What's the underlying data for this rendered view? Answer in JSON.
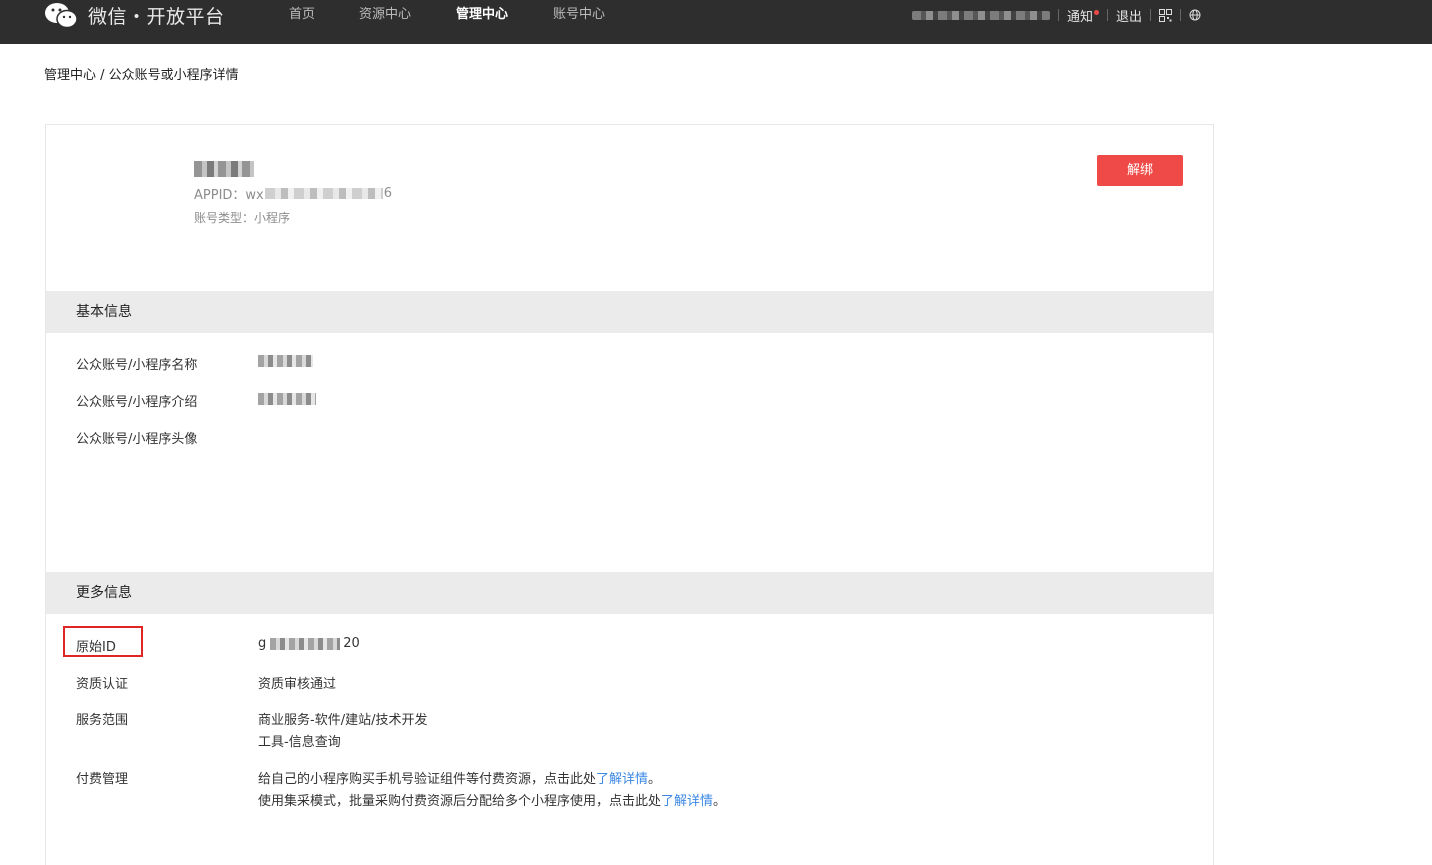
{
  "header": {
    "logo_text": "微信・开放平台",
    "nav": [
      "首页",
      "资源中心",
      "管理中心",
      "账号中心"
    ],
    "active_nav": "管理中心",
    "notice_label": "通知",
    "logout_label": "退出",
    "icons": [
      "wechat-logo-icon",
      "qr-code-icon",
      "globe-icon"
    ],
    "colors": {
      "bar": "#2e2e2e",
      "notice_dot": "#f04848"
    }
  },
  "breadcrumb": "管理中心 / 公众账号或小程序详情",
  "account": {
    "appid_prefix": "APPID：wx",
    "appid_suffix": "6",
    "type_text": "账号类型：小程序",
    "unbind_label": "解绑",
    "unbind_color": "#ef4a47"
  },
  "basic": {
    "title": "基本信息",
    "name_label": "公众账号/小程序名称",
    "intro_label": "公众账号/小程序介绍",
    "avatar_label": "公众账号/小程序头像"
  },
  "more": {
    "title": "更多信息",
    "orig_id_label": "原始ID",
    "orig_id_prefix": "g",
    "orig_id_suffix": "20",
    "qual_label": "资质认证",
    "qual_value": "资质审核通过",
    "scope_label": "服务范围",
    "scope_values": [
      "商业服务-软件/建站/技术开发",
      "工具-信息查询"
    ],
    "paid_label": "付费管理",
    "paid_line1": "给自己的小程序购买手机号验证组件等付费资源，点击此处",
    "paid_line1_link": "了解详情",
    "paid_line1_end": "。",
    "paid_line2": "使用集采模式，批量采购付费资源后分配给多个小程序使用，点击此处",
    "paid_line2_link": "了解详情",
    "paid_line2_end": "。",
    "link_color": "#3b88e5"
  }
}
